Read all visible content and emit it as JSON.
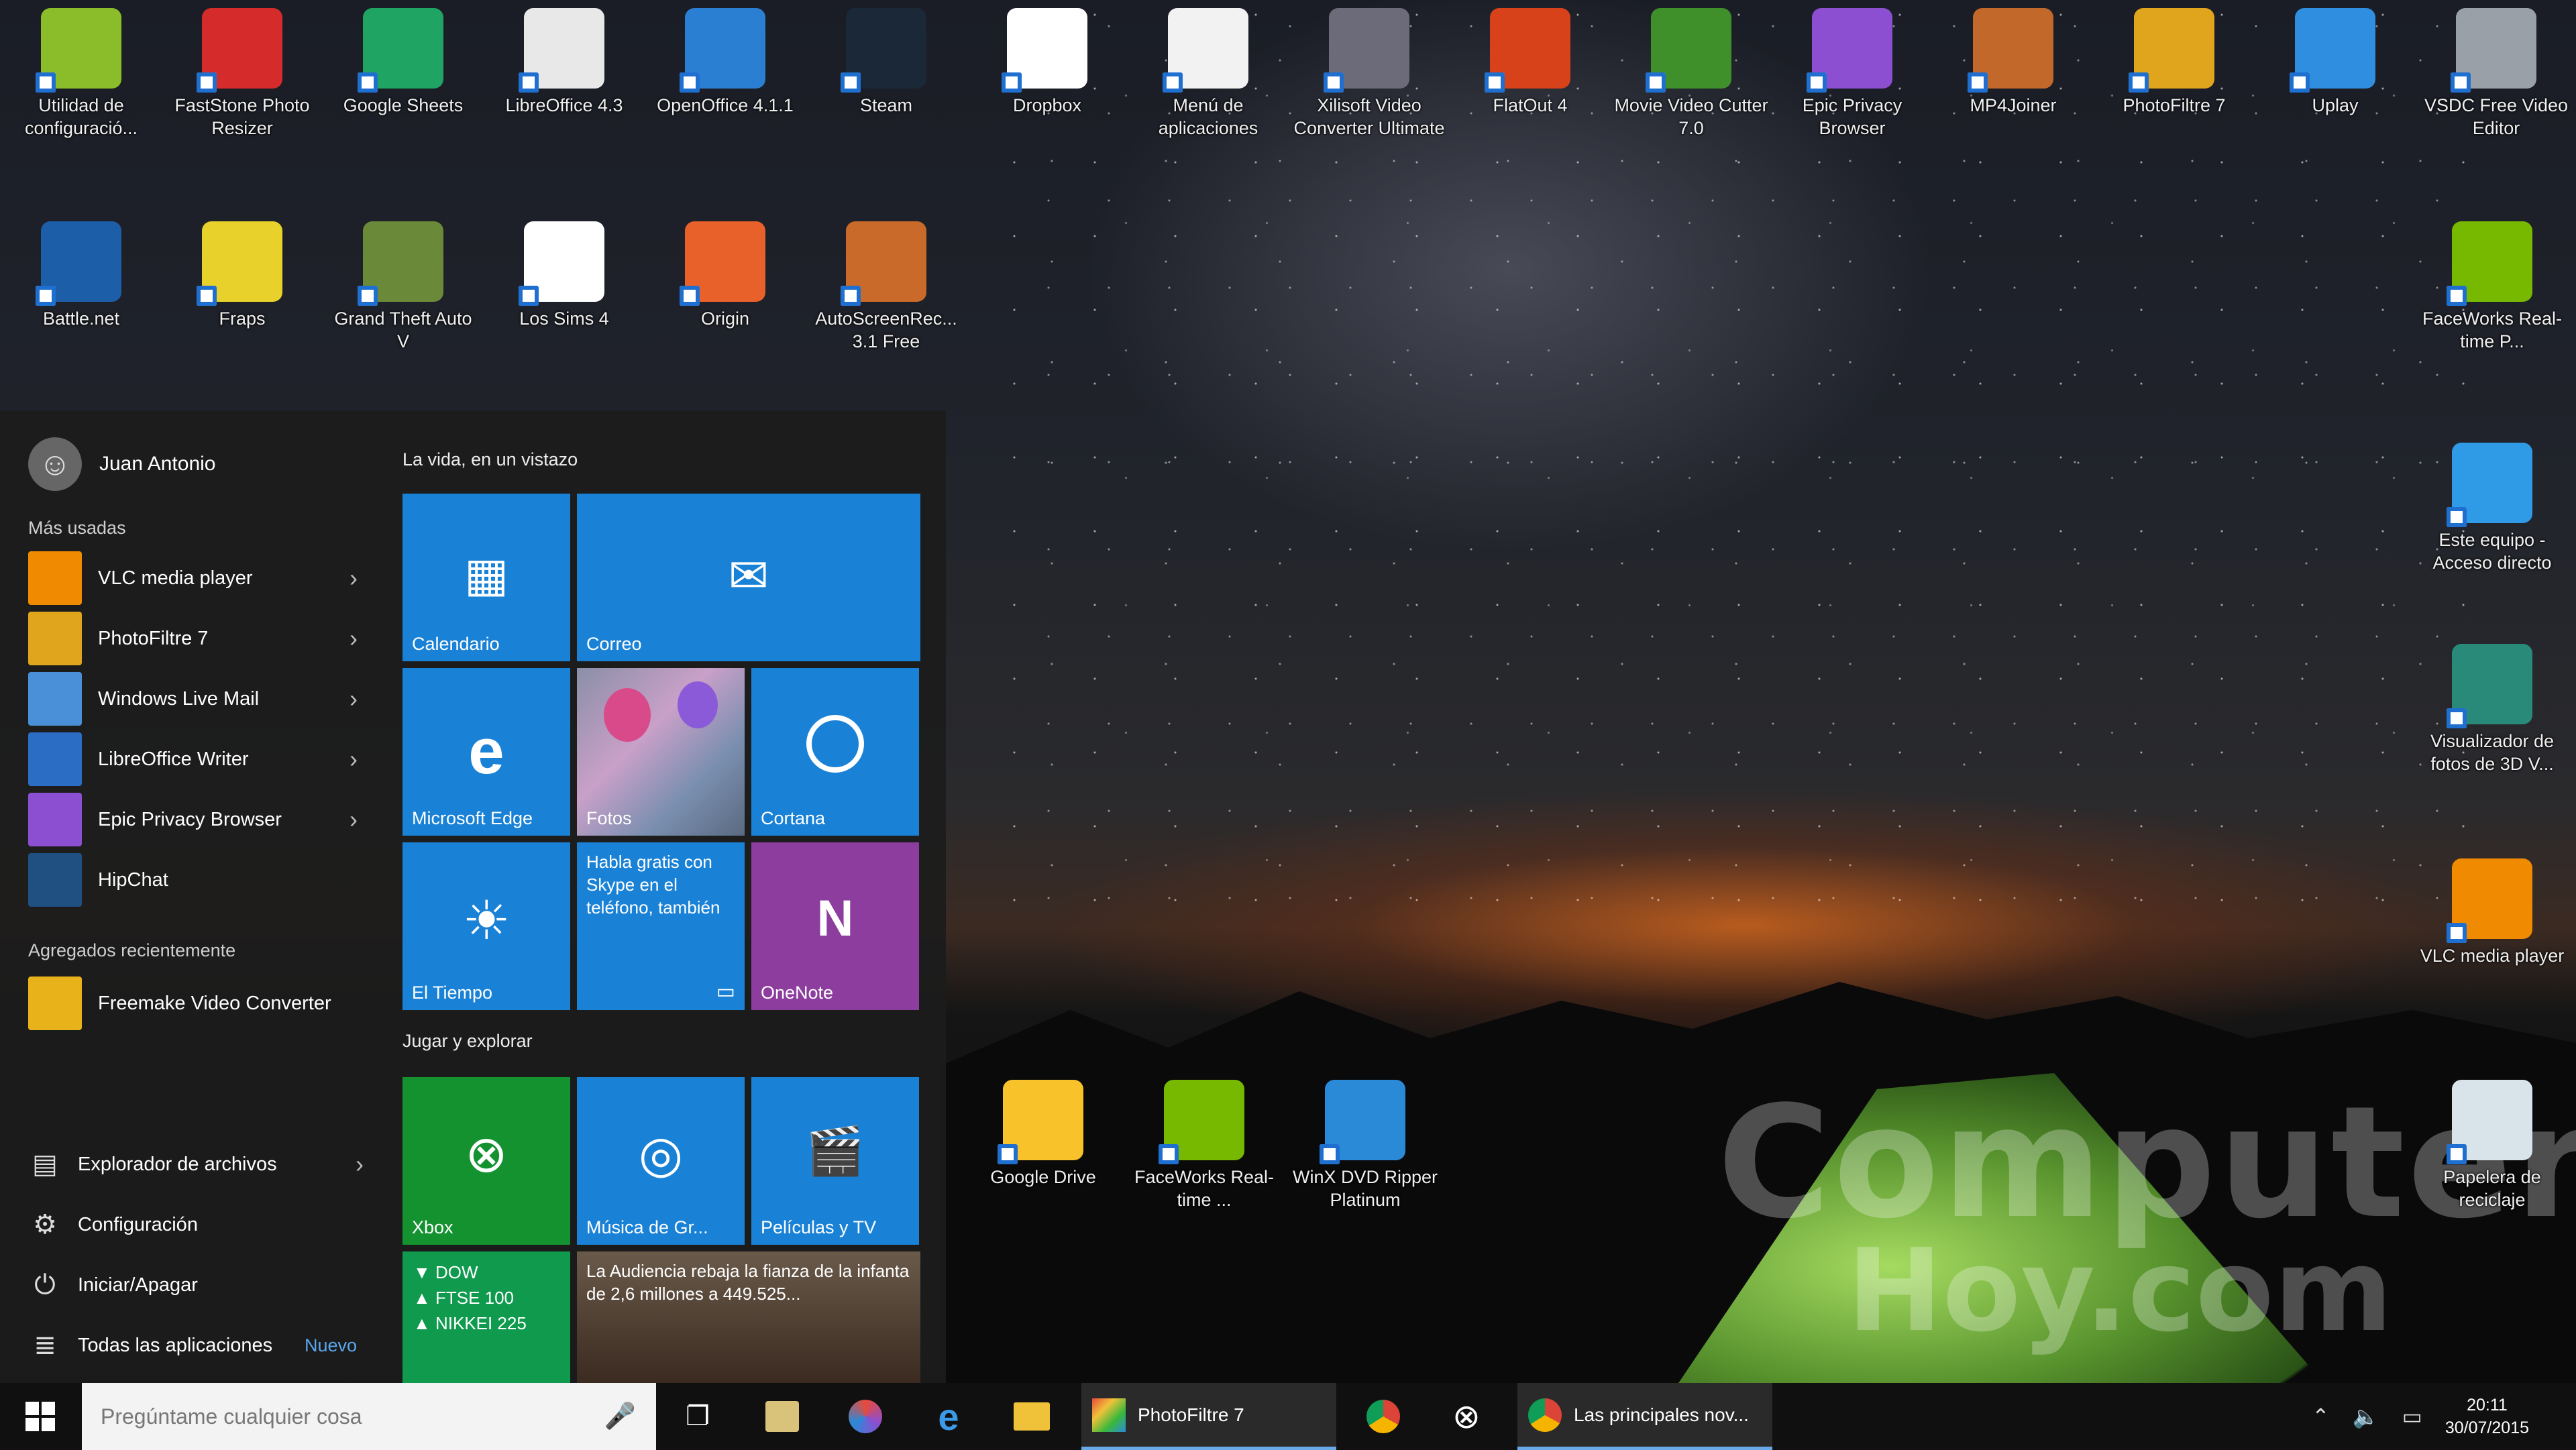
{
  "desktop_icons_top": [
    {
      "label": "Utilidad de configuració...",
      "color": "#8bbd2a"
    },
    {
      "label": "FastStone Photo Resizer",
      "color": "#d62b2b"
    },
    {
      "label": "Google Sheets",
      "color": "#1fa463"
    },
    {
      "label": "LibreOffice 4.3",
      "color": "#e8e8e8"
    },
    {
      "label": "OpenOffice 4.1.1",
      "color": "#2b7fd3"
    },
    {
      "label": "Steam",
      "color": "#1b2838"
    },
    {
      "label": "Dropbox",
      "color": "#ffffff"
    },
    {
      "label": "Menú de aplicaciones",
      "color": "#f2f2f2"
    },
    {
      "label": "Xilisoft Video Converter Ultimate",
      "color": "#6b6b7a"
    },
    {
      "label": "FlatOut 4",
      "color": "#d7421a"
    },
    {
      "label": "Movie Video Cutter 7.0",
      "color": "#3f8f2b"
    },
    {
      "label": "Epic Privacy Browser",
      "color": "#8c4fd1"
    },
    {
      "label": "MP4Joiner",
      "color": "#c2682a"
    },
    {
      "label": "PhotoFiltre 7",
      "color": "#e0a51c"
    },
    {
      "label": "Uplay",
      "color": "#2f8ee0"
    },
    {
      "label": "VSDC Free Video Editor",
      "color": "#9aa0a8"
    }
  ],
  "desktop_icons_second": [
    {
      "label": "Battle.net",
      "color": "#1c5ea8"
    },
    {
      "label": "Fraps",
      "color": "#e8d12a"
    },
    {
      "label": "Grand Theft Auto V",
      "color": "#6a8a3a"
    },
    {
      "label": "Los Sims 4",
      "color": "#ffffff"
    },
    {
      "label": "Origin",
      "color": "#e8602a"
    },
    {
      "label": "AutoScreenRec... 3.1 Free",
      "color": "#c96a2a"
    }
  ],
  "desktop_icons_right": [
    {
      "label": "FaceWorks Real-time P...",
      "color": "#76b900"
    },
    {
      "label": "Este equipo - Acceso directo",
      "color": "#2f9ae6"
    },
    {
      "label": "Visualizador de fotos de 3D V...",
      "color": "#2a8a7a"
    },
    {
      "label": "VLC media player",
      "color": "#f08a00"
    },
    {
      "label": "Papelera de reciclaje",
      "color": "#d8e4ea"
    }
  ],
  "desktop_icons_bottom": [
    {
      "label": "Google Drive",
      "color": "#f7c22a"
    },
    {
      "label": "FaceWorks Real-time ...",
      "color": "#76b900"
    },
    {
      "label": "WinX DVD Ripper Platinum",
      "color": "#2a8ad8"
    }
  ],
  "watermark": {
    "line1": "Computer",
    "line2": "Hoy.com"
  },
  "start_menu": {
    "user_name": "Juan Antonio",
    "most_used_heading": "Más usadas",
    "most_used": [
      {
        "label": "VLC media player",
        "color": "#f08a00",
        "icon": "vlc-icon"
      },
      {
        "label": "PhotoFiltre 7",
        "color": "#e0a51c",
        "icon": "photofiltre-icon"
      },
      {
        "label": "Windows Live Mail",
        "color": "#4a90d9",
        "icon": "mail-icon"
      },
      {
        "label": "LibreOffice Writer",
        "color": "#2b6cc4",
        "icon": "writer-icon"
      },
      {
        "label": "Epic Privacy Browser",
        "color": "#8c4fd1",
        "icon": "epic-icon"
      },
      {
        "label": "HipChat",
        "color": "#205081",
        "icon": "hipchat-icon"
      }
    ],
    "recent_heading": "Agregados recientemente",
    "recent": [
      {
        "label": "Freemake Video Converter",
        "color": "#e8b21a",
        "icon": "freemake-icon"
      }
    ],
    "system_items": [
      {
        "label": "Explorador de archivos",
        "icon": "folder-icon",
        "glyph": "▤"
      },
      {
        "label": "Configuración",
        "icon": "gear-icon",
        "glyph": "⚙"
      },
      {
        "label": "Iniciar/Apagar",
        "icon": "power-icon",
        "glyph": "⏻"
      },
      {
        "label": "Todas las aplicaciones",
        "icon": "all-apps-icon",
        "glyph": "≣",
        "badge": "Nuevo"
      }
    ],
    "group1_title": "La vida, en un vistazo",
    "group2_title": "Jugar y explorar",
    "tiles": {
      "calendario": "Calendario",
      "correo": "Correo",
      "edge": "Microsoft Edge",
      "fotos": "Fotos",
      "cortana": "Cortana",
      "tiempo": "El Tiempo",
      "skype_text": "Habla gratis con Skype en el teléfono, también",
      "onenote": "OneNote",
      "xbox": "Xbox",
      "musica": "Música de Gr...",
      "peliculas": "Películas y TV",
      "money_lines": [
        "▼ DOW",
        "▲ FTSE 100",
        "▲ NIKKEI 225"
      ],
      "news_text": "La Audiencia rebaja la fianza de la infanta de 2,6 millones a 449.525..."
    },
    "colors": {
      "tile_blue": "#1a82d6",
      "tile_green": "#13922f",
      "tile_purple": "#8c3d9e",
      "money_green": "#0f9a4e"
    }
  },
  "taskbar": {
    "search_placeholder": "Pregúntame cualquier cosa",
    "window_photofiltre": "PhotoFiltre 7",
    "window_chrome": "Las principales nov...",
    "time": "20:11",
    "date": "30/07/2015"
  }
}
